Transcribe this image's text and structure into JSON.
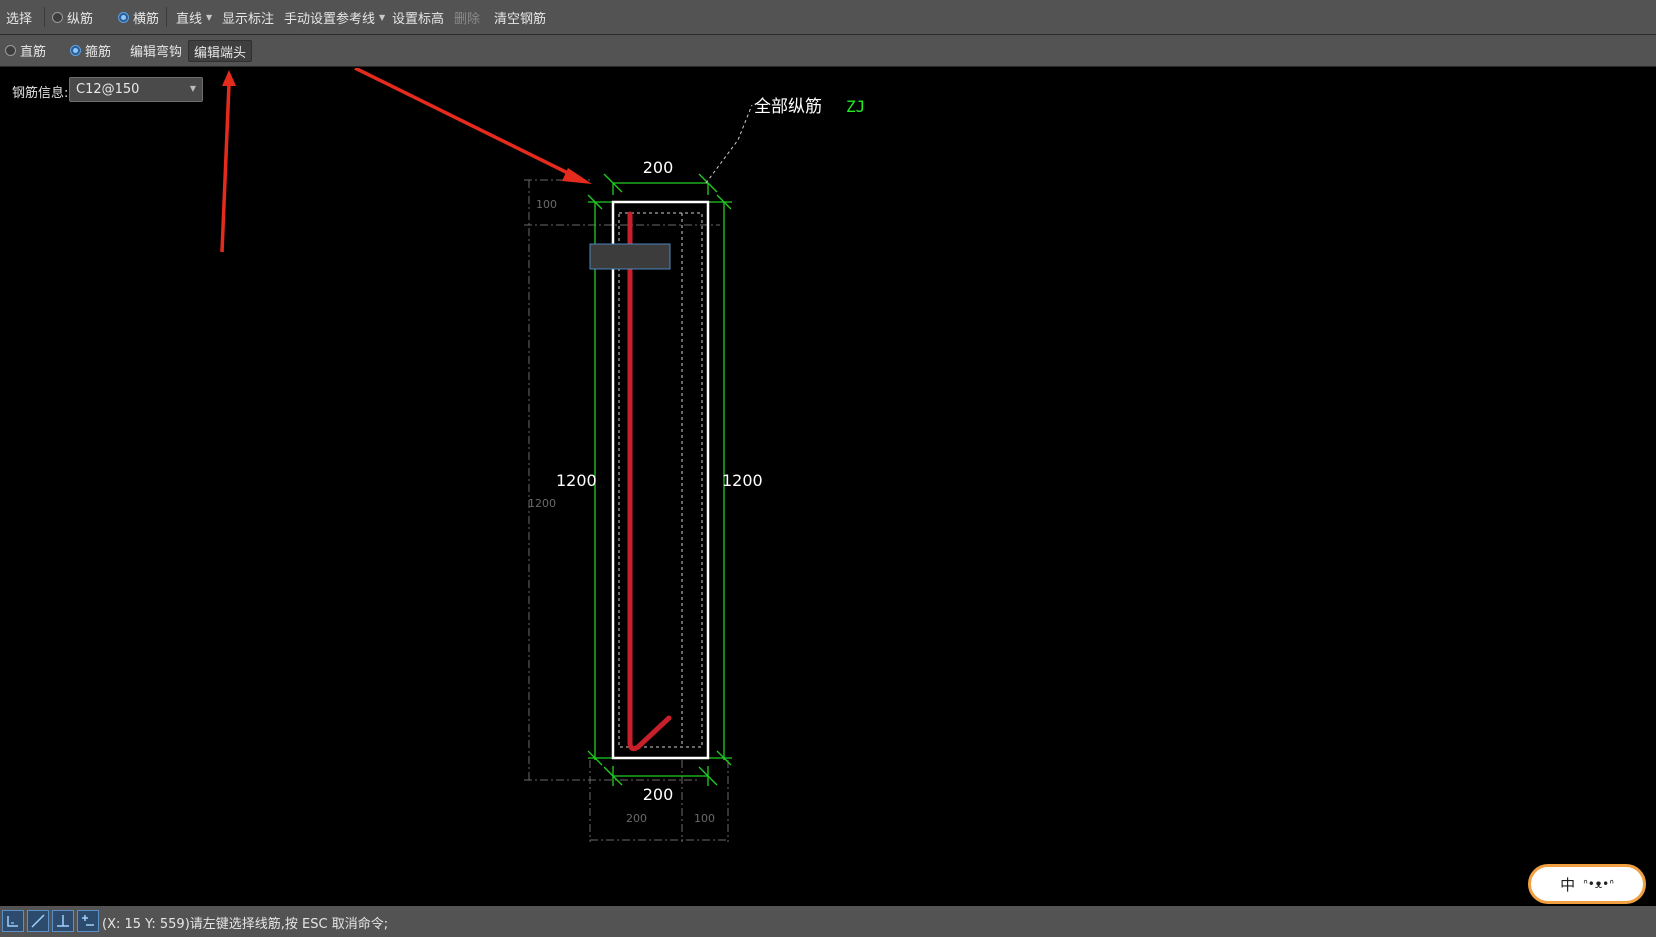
{
  "toolbar1": {
    "select": "选择",
    "longitudinal": "纵筋",
    "transverse": "横筋",
    "line": "直线",
    "show_dimensions": "显示标注",
    "manual_refline": "手动设置参考线",
    "set_elevation": "设置标高",
    "delete": "删除",
    "clear_rebar": "清空钢筋",
    "selected_radio": "横筋"
  },
  "toolbar2": {
    "straight": "直筋",
    "stirrup": "箍筋",
    "edit_hook": "编辑弯钩",
    "edit_end": "编辑端头",
    "selected_radio": "箍筋"
  },
  "rebar_info": {
    "label": "钢筋信息:",
    "value": "C12@150"
  },
  "drawing": {
    "callout_text": "全部纵筋",
    "callout_code": "ZJ",
    "dim_top": "200",
    "dim_bottom": "200",
    "dim_left": "1200",
    "dim_right": "1200",
    "faint_top_left": "100",
    "faint_left": "1200",
    "faint_bottom_left": "200",
    "faint_bottom_right": "100"
  },
  "status": {
    "text": "(X: 15 Y: 559)请左键选择线筋,按 ESC 取消命令;"
  },
  "ime": {
    "label": "中"
  },
  "colors": {
    "toolbar_bg": "#535353",
    "canvas_bg": "#000000",
    "rebar_red": "#c8202a",
    "dim_green": "#22cc22",
    "outline_white": "#ffffff",
    "arrow_red": "#e52a1e",
    "accent_blue": "#5aa0e6"
  }
}
